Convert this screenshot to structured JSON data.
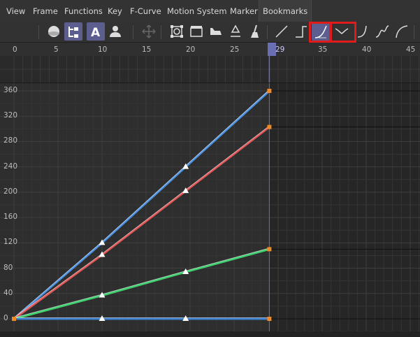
{
  "menu": [
    "View",
    "Frame",
    "Functions",
    "Key",
    "F-Curve",
    "Motion System",
    "Marker",
    "Bookmarks"
  ],
  "toolbar": {
    "buttons": [
      {
        "name": "sphere-icon",
        "on": false
      },
      {
        "name": "hierarchy-icon",
        "on": true
      },
      {
        "name": "text-a-icon",
        "on": true
      },
      {
        "name": "person-icon",
        "on": false
      },
      {
        "name": "move-arrows-icon",
        "on": false
      },
      {
        "name": "frame-selection-icon",
        "on": false
      },
      {
        "name": "film-clapper-icon",
        "on": false
      },
      {
        "name": "iron-icon",
        "on": false
      },
      {
        "name": "recycle-icon",
        "on": false
      },
      {
        "name": "broom-icon",
        "on": false
      },
      {
        "name": "linear-interp-icon",
        "on": false
      },
      {
        "name": "step-interp-icon",
        "on": false
      },
      {
        "name": "ease-in-icon",
        "on": true
      },
      {
        "name": "ease-both-icon",
        "on": false
      },
      {
        "name": "ease-out-icon",
        "on": false
      },
      {
        "name": "spline-icon",
        "on": false
      },
      {
        "name": "ease-curve-icon",
        "on": false
      }
    ]
  },
  "ruler": {
    "ticks": [
      "0",
      "5",
      "10",
      "15",
      "20",
      "25",
      "35",
      "40",
      "45"
    ],
    "current_frame": "29"
  },
  "y_axis": {
    "labels": [
      "360",
      "320",
      "280",
      "240",
      "200",
      "160",
      "120",
      "80",
      "40",
      "0"
    ]
  },
  "chart_data": {
    "type": "line",
    "x_range": [
      0,
      47
    ],
    "ylim": [
      0,
      375
    ],
    "current_frame": 29,
    "series": [
      {
        "color": "#4a90e2",
        "values": [
          [
            0,
            0
          ],
          [
            10,
            120
          ],
          [
            19.5,
            240
          ],
          [
            29,
            360
          ]
        ]
      },
      {
        "color": "#e05555",
        "values": [
          [
            0,
            0
          ],
          [
            10,
            101
          ],
          [
            19.5,
            202
          ],
          [
            29,
            303
          ]
        ]
      },
      {
        "color": "#3ecf6e",
        "values": [
          [
            0,
            0
          ],
          [
            10,
            37
          ],
          [
            19.5,
            74
          ],
          [
            29,
            110
          ]
        ]
      },
      {
        "color": "#3a7fd0",
        "values": [
          [
            0,
            0
          ],
          [
            10,
            0
          ],
          [
            19.5,
            0
          ],
          [
            29,
            0
          ]
        ]
      }
    ]
  }
}
